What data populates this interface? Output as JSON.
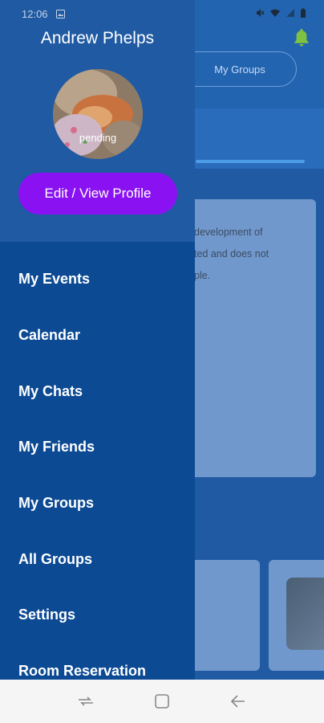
{
  "status_bar": {
    "time": "12:06"
  },
  "background": {
    "tab_label": "My Groups",
    "card_lines": [
      "development of",
      "ted and does not",
      "ple."
    ]
  },
  "drawer": {
    "user_name": "Andrew Phelps",
    "avatar_status": "pending",
    "edit_button_label": "Edit / View Profile",
    "menu_items": [
      {
        "label": "My Events"
      },
      {
        "label": "Calendar"
      },
      {
        "label": "My Chats"
      },
      {
        "label": "My Friends"
      },
      {
        "label": "My Groups"
      },
      {
        "label": "All Groups"
      },
      {
        "label": "Settings"
      },
      {
        "label": "Room Reservation"
      }
    ]
  },
  "colors": {
    "drawer_background": "#0c4a94",
    "header_background": "#1f5aa3",
    "edit_button": "#8a12f2",
    "bell": "#7fc241"
  },
  "icons": {
    "bell": "bell-icon",
    "recents": "recents-icon",
    "home": "home-icon",
    "back": "back-icon"
  }
}
